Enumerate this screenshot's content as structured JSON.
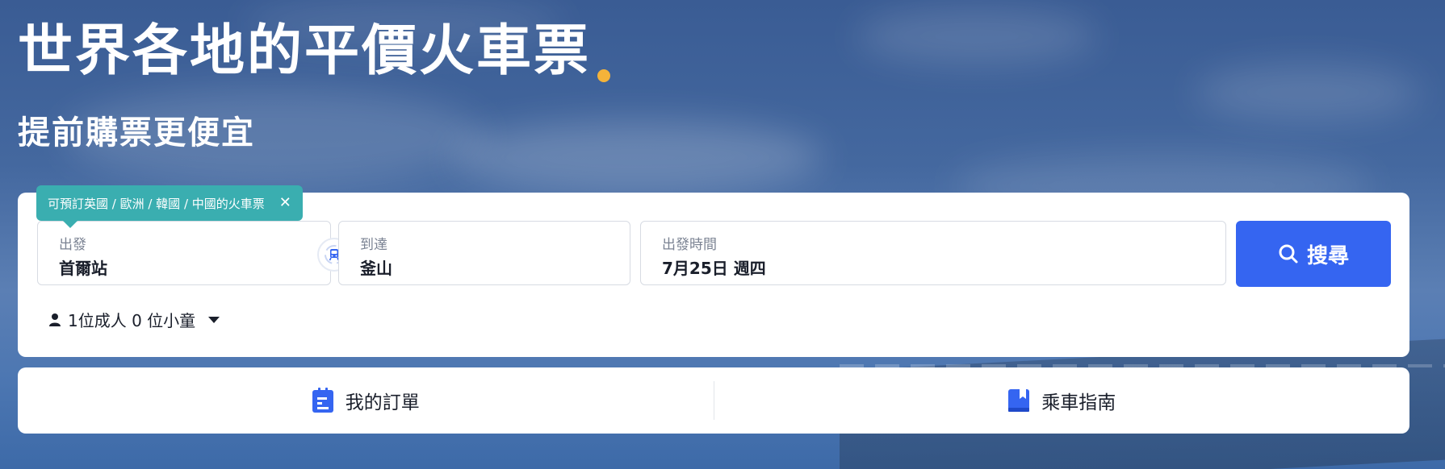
{
  "hero": {
    "title": "世界各地的平價火車票",
    "subtitle": "提前購票更便宜",
    "accent_dot_color": "#f5b33a"
  },
  "search": {
    "tooltip": "可預訂英國 / 歐洲 / 韓國 / 中國的火車票",
    "from_label": "出發",
    "from_value": "首爾站",
    "to_label": "到達",
    "to_value": "釜山",
    "date_label": "出發時間",
    "date_value": "7月25日 週四",
    "search_button": "搜尋",
    "passengers": "1位成人 0 位小童",
    "button_color": "#3565f1",
    "tooltip_color": "#3aaeb0"
  },
  "quick_links": [
    {
      "label": "我的訂單",
      "icon": "clipboard-icon"
    },
    {
      "label": "乘車指南",
      "icon": "book-icon"
    }
  ]
}
